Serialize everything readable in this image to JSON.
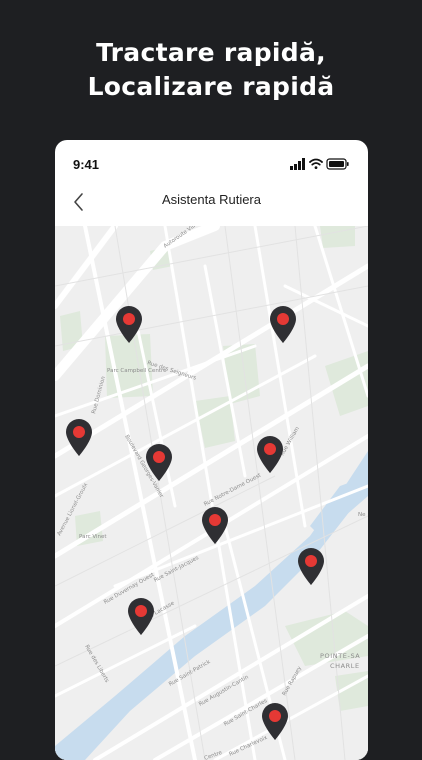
{
  "headline": {
    "line1": "Tractare rapidă,",
    "line2": "Localizare rapidă"
  },
  "status": {
    "time": "9:41"
  },
  "nav": {
    "title": "Asistenta Rutiera"
  },
  "map": {
    "streets": [
      "Autoroute Ville",
      "Parc Campbell Centre",
      "Rue des Seigneurs",
      "Rue Dominion",
      "Boulevard Georges-Vanier",
      "Rue Notre-Dame Ouest",
      "Rue William",
      "Avenue Lionel-Groulx",
      "Parc Vinet",
      "Rue Duvernay Ouest",
      "Rue Lacasse",
      "Rue Saint-Jacques",
      "Rue des Liberts",
      "Rue Saint-Patrick",
      "Rue Augustin-Cantin",
      "Rue Saint-Charles",
      "Rue Rapuey",
      "Rue Charlevoix",
      "Centre",
      "Ne",
      "POINTE-SA",
      "CHARLE"
    ],
    "marker_color": "#e53935",
    "pin_color": "#2f2f33"
  }
}
